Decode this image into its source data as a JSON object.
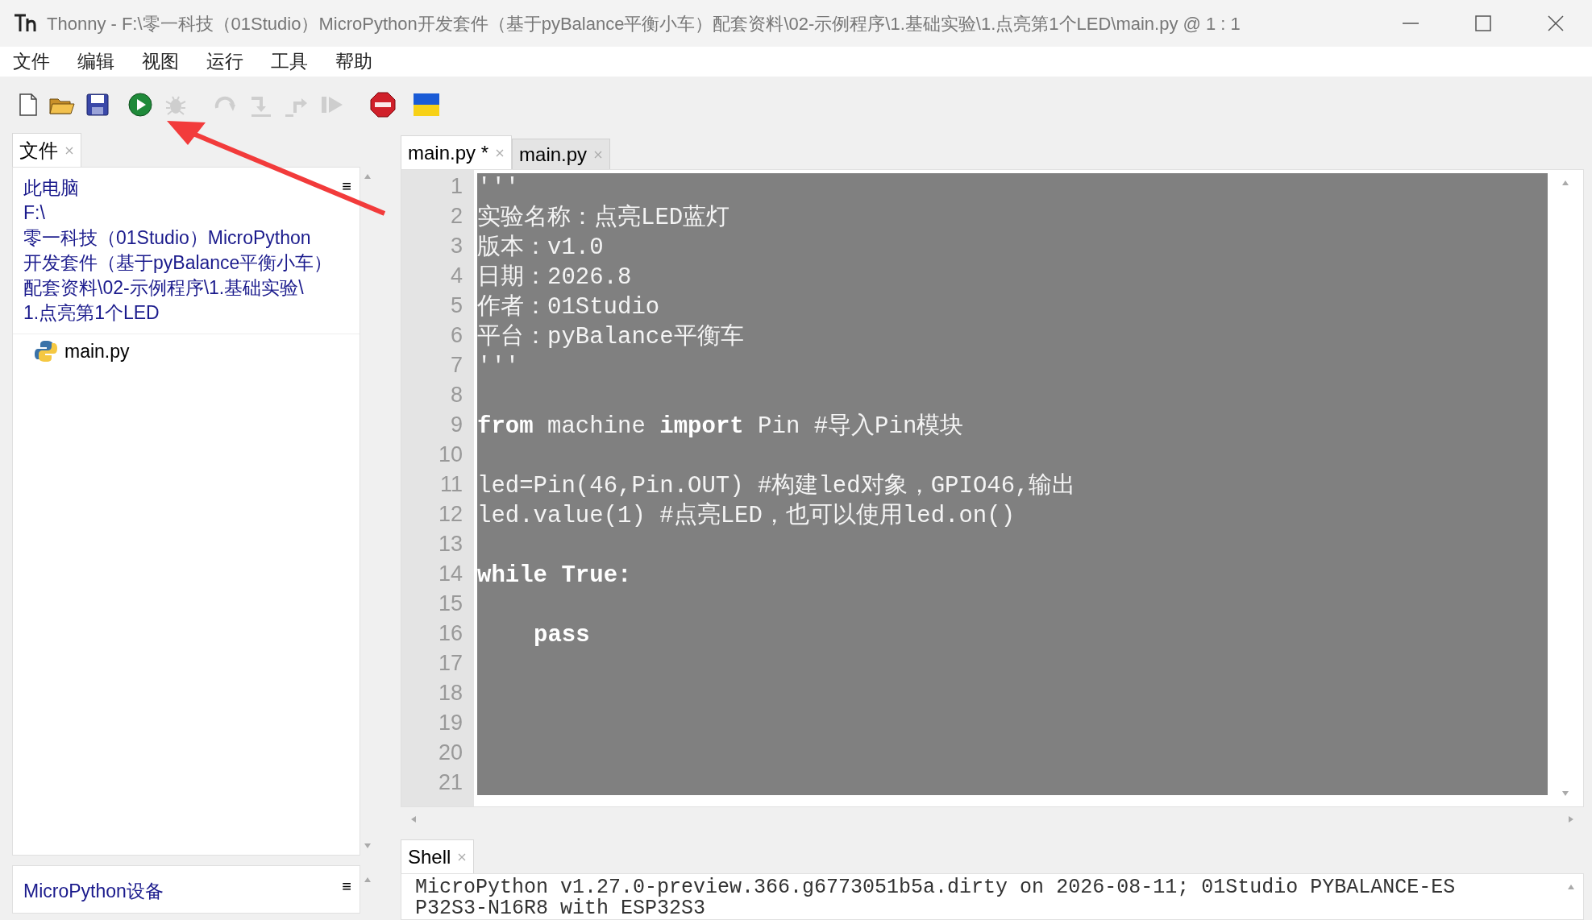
{
  "window": {
    "title": "Thonny  -  F:\\零一科技（01Studio）MicroPython开发套件（基于pyBalance平衡小车）配套资料\\02-示例程序\\1.基础实验\\1.点亮第1个LED\\main.py  @  1 : 1"
  },
  "menu": [
    "文件",
    "编辑",
    "视图",
    "运行",
    "工具",
    "帮助"
  ],
  "toolbar": [
    {
      "kind": "new",
      "disabled": false
    },
    {
      "kind": "open",
      "disabled": false
    },
    {
      "kind": "save",
      "disabled": false
    },
    {
      "kind": "run",
      "disabled": false
    },
    {
      "kind": "debug",
      "disabled": true
    },
    {
      "kind": "step_over",
      "disabled": true
    },
    {
      "kind": "step_into",
      "disabled": true
    },
    {
      "kind": "step_out",
      "disabled": true
    },
    {
      "kind": "resume",
      "disabled": true
    },
    {
      "kind": "stop",
      "disabled": false
    },
    {
      "kind": "flag",
      "disabled": false
    }
  ],
  "files_panel": {
    "tabs": [
      {
        "label": "文件",
        "selected": true
      }
    ],
    "location": [
      "此电脑",
      "F:\\",
      "零一科技（01Studio）MicroPython",
      "开发套件（基于pyBalance平衡小车）",
      "配套资料\\02-示例程序\\1.基础实验\\",
      "1.点亮第1个LED"
    ],
    "menu_glyph": "≡",
    "files": [
      {
        "name": "main.py",
        "kind": "python"
      }
    ]
  },
  "device_panel": {
    "title": "MicroPython设备",
    "menu_glyph": "≡"
  },
  "editor": {
    "tabs": [
      {
        "label": "main.py *",
        "selected": true
      },
      {
        "label": "main.py",
        "selected": false
      }
    ],
    "lines": [
      {
        "number": "1",
        "segments": [
          {
            "text": "'''",
            "kind": "plain"
          }
        ]
      },
      {
        "number": "2",
        "segments": [
          {
            "text": "实验名称：点亮LED蓝灯",
            "kind": "plain"
          }
        ]
      },
      {
        "number": "3",
        "segments": [
          {
            "text": "版本：v1.0",
            "kind": "plain"
          }
        ]
      },
      {
        "number": "4",
        "segments": [
          {
            "text": "日期：2026.8",
            "kind": "plain"
          }
        ]
      },
      {
        "number": "5",
        "segments": [
          {
            "text": "作者：01Studio",
            "kind": "plain"
          }
        ]
      },
      {
        "number": "6",
        "segments": [
          {
            "text": "平台：pyBalance平衡车",
            "kind": "plain"
          }
        ]
      },
      {
        "number": "7",
        "segments": [
          {
            "text": "'''",
            "kind": "plain"
          }
        ]
      },
      {
        "number": "8"
      },
      {
        "number": "9",
        "segments": [
          {
            "text": "from",
            "kind": "keyword"
          },
          {
            "text": " machine ",
            "kind": "plain"
          },
          {
            "text": "import",
            "kind": "keyword"
          },
          {
            "text": " Pin #导入Pin模块",
            "kind": "plain"
          }
        ]
      },
      {
        "number": "10"
      },
      {
        "number": "11",
        "segments": [
          {
            "text": "led=Pin(46,Pin.OUT) #构建led对象，GPIO46,输出",
            "kind": "plain"
          }
        ]
      },
      {
        "number": "12",
        "segments": [
          {
            "text": "led.value(1) #点亮LED，也可以使用led.on()",
            "kind": "plain"
          }
        ]
      },
      {
        "number": "13"
      },
      {
        "number": "14",
        "segments": [
          {
            "text": "while True:",
            "kind": "keyword"
          }
        ]
      },
      {
        "number": "15"
      },
      {
        "number": "16",
        "indented": true,
        "segments": [
          {
            "text": "pass",
            "kind": "keyword"
          }
        ]
      },
      {
        "number": "17"
      },
      {
        "number": "18"
      },
      {
        "number": "19"
      },
      {
        "number": "20"
      },
      {
        "number": "21"
      }
    ]
  },
  "shell": {
    "tabs": [
      {
        "label": "Shell",
        "selected": true
      }
    ],
    "lines": [
      "MicroPython v1.27.0-preview.366.g6773051b5a.dirty on 2026-08-11; 01Studio PYBALANCE-ES",
      "P32S3-N16R8 with ESP32S3"
    ]
  }
}
